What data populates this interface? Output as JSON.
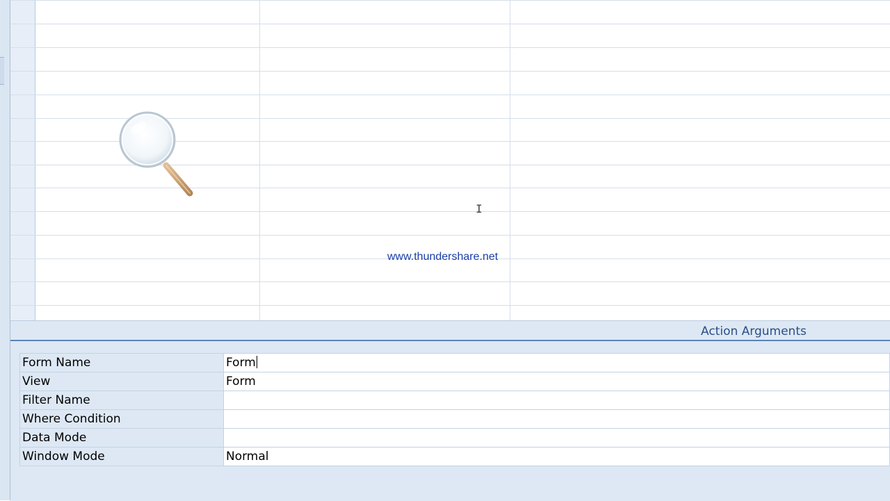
{
  "watermark": "www.thundershare.net",
  "action_arguments": {
    "title": "Action Arguments",
    "rows": [
      {
        "label": "Form Name",
        "value": "Form"
      },
      {
        "label": "View",
        "value": "Form"
      },
      {
        "label": "Filter Name",
        "value": ""
      },
      {
        "label": "Where Condition",
        "value": ""
      },
      {
        "label": "Data Mode",
        "value": ""
      },
      {
        "label": "Window Mode",
        "value": "Normal"
      }
    ]
  },
  "colors": {
    "pane_background": "#dde8f4",
    "header_accent": "#5a84b8",
    "watermark_text": "#1a3fa8"
  }
}
